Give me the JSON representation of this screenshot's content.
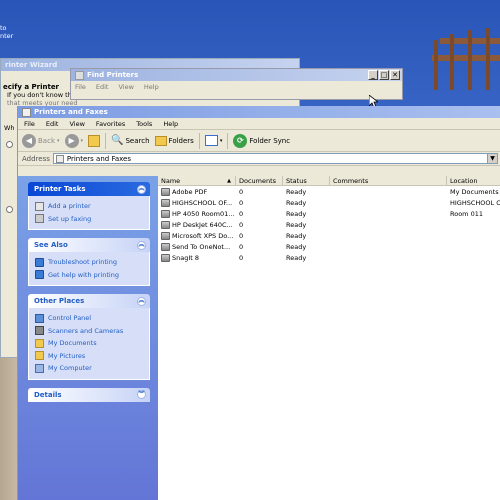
{
  "desktop": {
    "left_strip_text": [
      "to",
      "nter"
    ],
    "left_strip_bottom": "Wh"
  },
  "wizard": {
    "title": "rinter Wizard",
    "heading": "ecify a Printer",
    "subtext": "If you don't know the",
    "subtext2": "that meets your need",
    "options_prefix": "Wh"
  },
  "find_printers": {
    "title": "Find Printers",
    "menu": [
      "File",
      "Edit",
      "View",
      "Help"
    ]
  },
  "explorer": {
    "title": "Printers and Faxes",
    "menu": [
      "File",
      "Edit",
      "View",
      "Favorites",
      "Tools",
      "Help"
    ],
    "toolbar": {
      "back": "Back",
      "search": "Search",
      "folders": "Folders",
      "folder_sync": "Folder Sync"
    },
    "address_label": "Address",
    "address_value": "Printers and Faxes",
    "task_pane": {
      "printer_tasks": {
        "title": "Printer Tasks",
        "items": [
          "Add a printer",
          "Set up faxing"
        ]
      },
      "see_also": {
        "title": "See Also",
        "items": [
          "Troubleshoot printing",
          "Get help with printing"
        ]
      },
      "other_places": {
        "title": "Other Places",
        "items": [
          "Control Panel",
          "Scanners and Cameras",
          "My Documents",
          "My Pictures",
          "My Computer"
        ]
      },
      "details": {
        "title": "Details"
      }
    },
    "columns": [
      "Name",
      "Documents",
      "Status",
      "Comments",
      "Location"
    ],
    "printers": [
      {
        "name": "Adobe PDF",
        "docs": "0",
        "status": "Ready",
        "comments": "",
        "location": "My Documents"
      },
      {
        "name": "HIGHSCHOOL OF...",
        "docs": "0",
        "status": "Ready",
        "comments": "",
        "location": "HIGHSCHOOL O"
      },
      {
        "name": "HP 4050 Room01...",
        "docs": "0",
        "status": "Ready",
        "comments": "",
        "location": "Room 011"
      },
      {
        "name": "HP DeskJet 640C...",
        "docs": "0",
        "status": "Ready",
        "comments": "",
        "location": ""
      },
      {
        "name": "Microsoft XPS Do...",
        "docs": "0",
        "status": "Ready",
        "comments": "",
        "location": ""
      },
      {
        "name": "Send To OneNot...",
        "docs": "0",
        "status": "Ready",
        "comments": "",
        "location": ""
      },
      {
        "name": "SnagIt 8",
        "docs": "0",
        "status": "Ready",
        "comments": "",
        "location": ""
      }
    ]
  },
  "colors": {
    "xp_blue": "#0a5ee8",
    "task_pane_bg": "#6f8edf",
    "link_blue": "#215dc6",
    "window_face": "#ece9d8"
  }
}
